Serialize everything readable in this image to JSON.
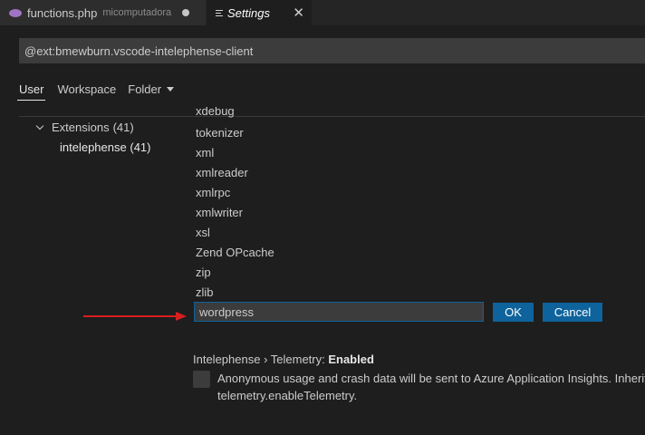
{
  "tabs": [
    {
      "title": "functions.php",
      "description": "micomputadora",
      "active": false,
      "dirty": true
    },
    {
      "title": "Settings",
      "active": true
    }
  ],
  "search": {
    "value": "@ext:bmewburn.vscode-intelephense-client"
  },
  "scopes": [
    "User",
    "Workspace",
    "Folder"
  ],
  "toc": {
    "extensions_label": "Extensions",
    "extensions_count": "(41)",
    "intelephense_label": "intelephense",
    "intelephense_count": "(41)"
  },
  "stubs": {
    "cut_off": "xdebug",
    "items": [
      "tokenizer",
      "xml",
      "xmlreader",
      "xmlrpc",
      "xmlwriter",
      "xsl",
      "Zend OPcache",
      "zip",
      "zlib"
    ],
    "edit_value": "wordpress",
    "ok_label": "OK",
    "cancel_label": "Cancel"
  },
  "telemetry": {
    "prefix": "Intelephense › Telemetry: ",
    "value": "Enabled",
    "description_line1": "Anonymous usage and crash data will be sent to Azure Application Insights. Inherits",
    "description_line2": "telemetry.enableTelemetry."
  },
  "colors": {
    "accent_button": "#0e639c",
    "annotation_arrow": "#d81e1e",
    "php_icon": "#a074c4"
  },
  "icons": {
    "php_tab": "php-elephant-icon",
    "settings_tab": "settings-lines-icon",
    "close": "close-icon",
    "folder_dropdown": "chevron-down-icon",
    "toc_expand": "chevron-down-icon"
  }
}
